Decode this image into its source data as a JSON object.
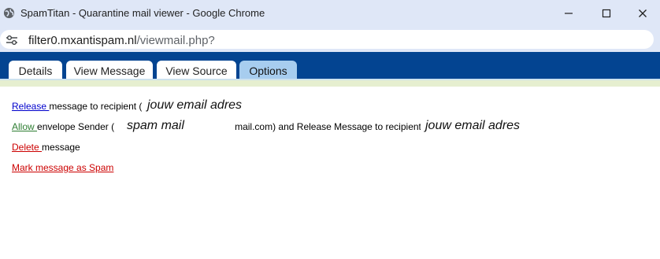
{
  "window": {
    "title": "SpamTitan - Quarantine mail viewer - Google Chrome"
  },
  "addressbar": {
    "url_host": "filter0.mxantispam.nl",
    "url_path": "/viewmail.php?"
  },
  "tabs": [
    {
      "label": "Details",
      "active": false
    },
    {
      "label": "View Message",
      "active": false
    },
    {
      "label": "View Source",
      "active": false
    },
    {
      "label": "Options",
      "active": true
    }
  ],
  "options": {
    "release": {
      "link": "Release ",
      "text": "message to recipient ("
    },
    "allow": {
      "link": "Allow ",
      "text_before": "envelope Sender (",
      "text_after": "mail.com) and Release Message to recipient"
    },
    "delete": {
      "link": "Delete ",
      "text": "message"
    },
    "spam": {
      "link": "Mark message as Spam"
    }
  },
  "annotations": {
    "recipient_1": "jouw email adres",
    "sender": "spam mail",
    "recipient_2": "jouw email adres"
  },
  "colors": {
    "titlebar": "#dfe7f7",
    "tabband": "#034491",
    "active_tab": "#a7cdef",
    "release_link": "#0000cc",
    "allow_link": "#2e7d32",
    "danger_link": "#cc0000"
  }
}
